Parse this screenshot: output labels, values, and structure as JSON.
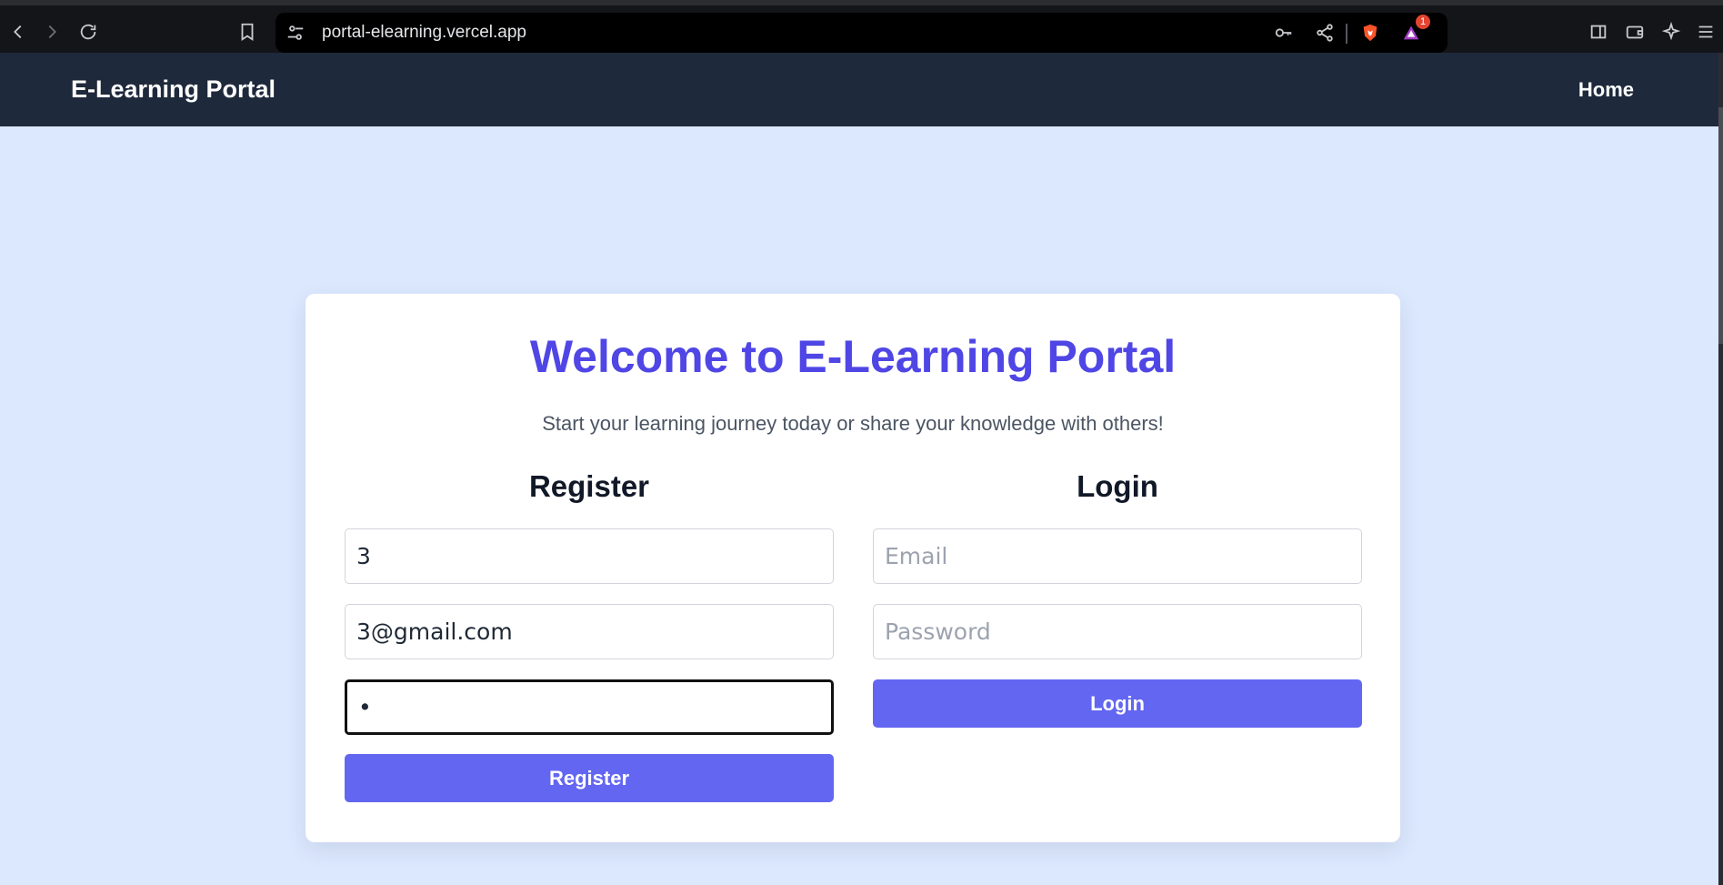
{
  "browser": {
    "url": "portal-elearning.vercel.app",
    "notification_count": "1"
  },
  "navbar": {
    "brand": "E-Learning Portal",
    "home_link": "Home"
  },
  "card": {
    "title": "Welcome to E-Learning Portal",
    "subtitle": "Start your learning journey today or share your knowledge with others!"
  },
  "register": {
    "heading": "Register",
    "name_value": "3",
    "email_value": "3@gmail.com",
    "password_value": "•",
    "button_label": "Register"
  },
  "login": {
    "heading": "Login",
    "email_placeholder": "Email",
    "password_placeholder": "Password",
    "button_label": "Login"
  },
  "colors": {
    "accent": "#6366f1",
    "title": "#4f46e5",
    "navbar": "#1e293b",
    "page_bg": "#dce8fe"
  }
}
